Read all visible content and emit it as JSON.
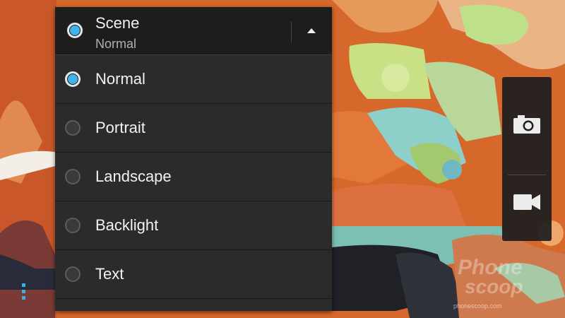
{
  "scene_dropdown": {
    "title": "Scene",
    "selected_value": "Normal",
    "options": [
      {
        "label": "Normal",
        "selected": true
      },
      {
        "label": "Portrait",
        "selected": false
      },
      {
        "label": "Landscape",
        "selected": false
      },
      {
        "label": "Backlight",
        "selected": false
      },
      {
        "label": "Text",
        "selected": false
      }
    ]
  },
  "mode_switcher": {
    "items": [
      {
        "icon": "camera-icon",
        "active": true
      },
      {
        "icon": "video-camera-icon",
        "active": false
      }
    ]
  },
  "menu": {
    "icon": "menu-dots-icon"
  },
  "watermark": {
    "line1": "Phone",
    "line2": "scoop",
    "url": "phonescoop.com"
  },
  "colors": {
    "accent": "#41b3ec",
    "panel_bg": "#2b2b2b",
    "header_bg": "#1d1d1d",
    "text": "#f2f2f2",
    "subtext": "#b0b0b0"
  }
}
